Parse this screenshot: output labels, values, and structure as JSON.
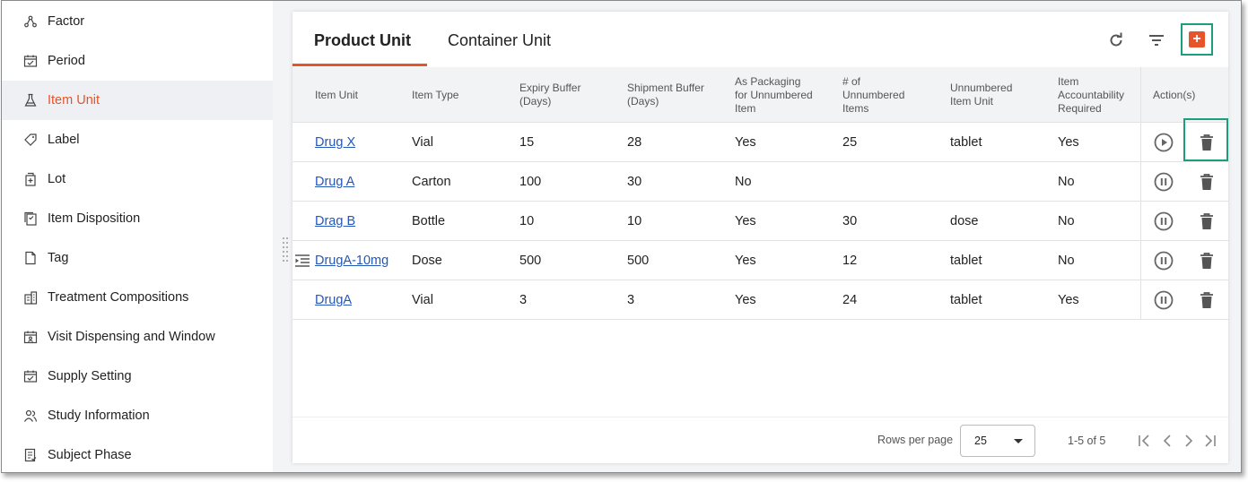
{
  "sidebar": {
    "items": [
      {
        "label": "Factor",
        "icon": "factor-icon"
      },
      {
        "label": "Period",
        "icon": "period-icon"
      },
      {
        "label": "Item Unit",
        "icon": "flask-icon",
        "active": true
      },
      {
        "label": "Label",
        "icon": "label-icon"
      },
      {
        "label": "Lot",
        "icon": "lot-icon"
      },
      {
        "label": "Item Disposition",
        "icon": "disposition-icon"
      },
      {
        "label": "Tag",
        "icon": "tag-icon"
      },
      {
        "label": "Treatment Compositions",
        "icon": "building-icon"
      },
      {
        "label": "Visit Dispensing and Window",
        "icon": "visit-icon"
      },
      {
        "label": "Supply Setting",
        "icon": "supply-icon"
      },
      {
        "label": "Study Information",
        "icon": "people-icon"
      },
      {
        "label": "Subject Phase",
        "icon": "document-icon"
      }
    ]
  },
  "tabs": [
    {
      "label": "Product Unit",
      "active": true
    },
    {
      "label": "Container Unit",
      "active": false
    }
  ],
  "toolbar": {
    "refresh_icon": "refresh-icon",
    "filter_icon": "filter-icon",
    "add_icon": "add-icon",
    "add_symbol": "+"
  },
  "table": {
    "headers": {
      "item_unit": "Item Unit",
      "item_type": "Item Type",
      "expiry": "Expiry Buffer (Days)",
      "shipment": "Shipment Buffer (Days)",
      "packaging": "As Packaging for Unnumbered Item",
      "num_items": "# of Unnumbered Items",
      "unnumbered_unit": "Unnumbered Item Unit",
      "accountability": "Item Accountability Required",
      "actions": "Action(s)"
    },
    "rows": [
      {
        "item_unit": "Drug X",
        "item_type": "Vial",
        "expiry": "15",
        "shipment": "28",
        "packaging": "Yes",
        "num_items": "25",
        "unnumbered_unit": "tablet",
        "accountability": "Yes",
        "state": "play"
      },
      {
        "item_unit": "Drug A",
        "item_type": "Carton",
        "expiry": "100",
        "shipment": "30",
        "packaging": "No",
        "num_items": "",
        "unnumbered_unit": "",
        "accountability": "No",
        "state": "pause"
      },
      {
        "item_unit": "Drag B",
        "item_type": "Bottle",
        "expiry": "10",
        "shipment": "10",
        "packaging": "Yes",
        "num_items": "30",
        "unnumbered_unit": "dose",
        "accountability": "No",
        "state": "pause"
      },
      {
        "item_unit": "DrugA-10mg",
        "item_type": "Dose",
        "expiry": "500",
        "shipment": "500",
        "packaging": "Yes",
        "num_items": "12",
        "unnumbered_unit": "tablet",
        "accountability": "No",
        "state": "pause",
        "indent": true
      },
      {
        "item_unit": "DrugA",
        "item_type": "Vial",
        "expiry": "3",
        "shipment": "3",
        "packaging": "Yes",
        "num_items": "24",
        "unnumbered_unit": "tablet",
        "accountability": "Yes",
        "state": "pause"
      }
    ]
  },
  "footer": {
    "rows_per_page_label": "Rows per page",
    "rows_per_page_value": "25",
    "range": "1-5 of 5"
  },
  "colors": {
    "accent": "#e8542a",
    "highlight": "#1a9e7e",
    "link": "#2457b7"
  }
}
